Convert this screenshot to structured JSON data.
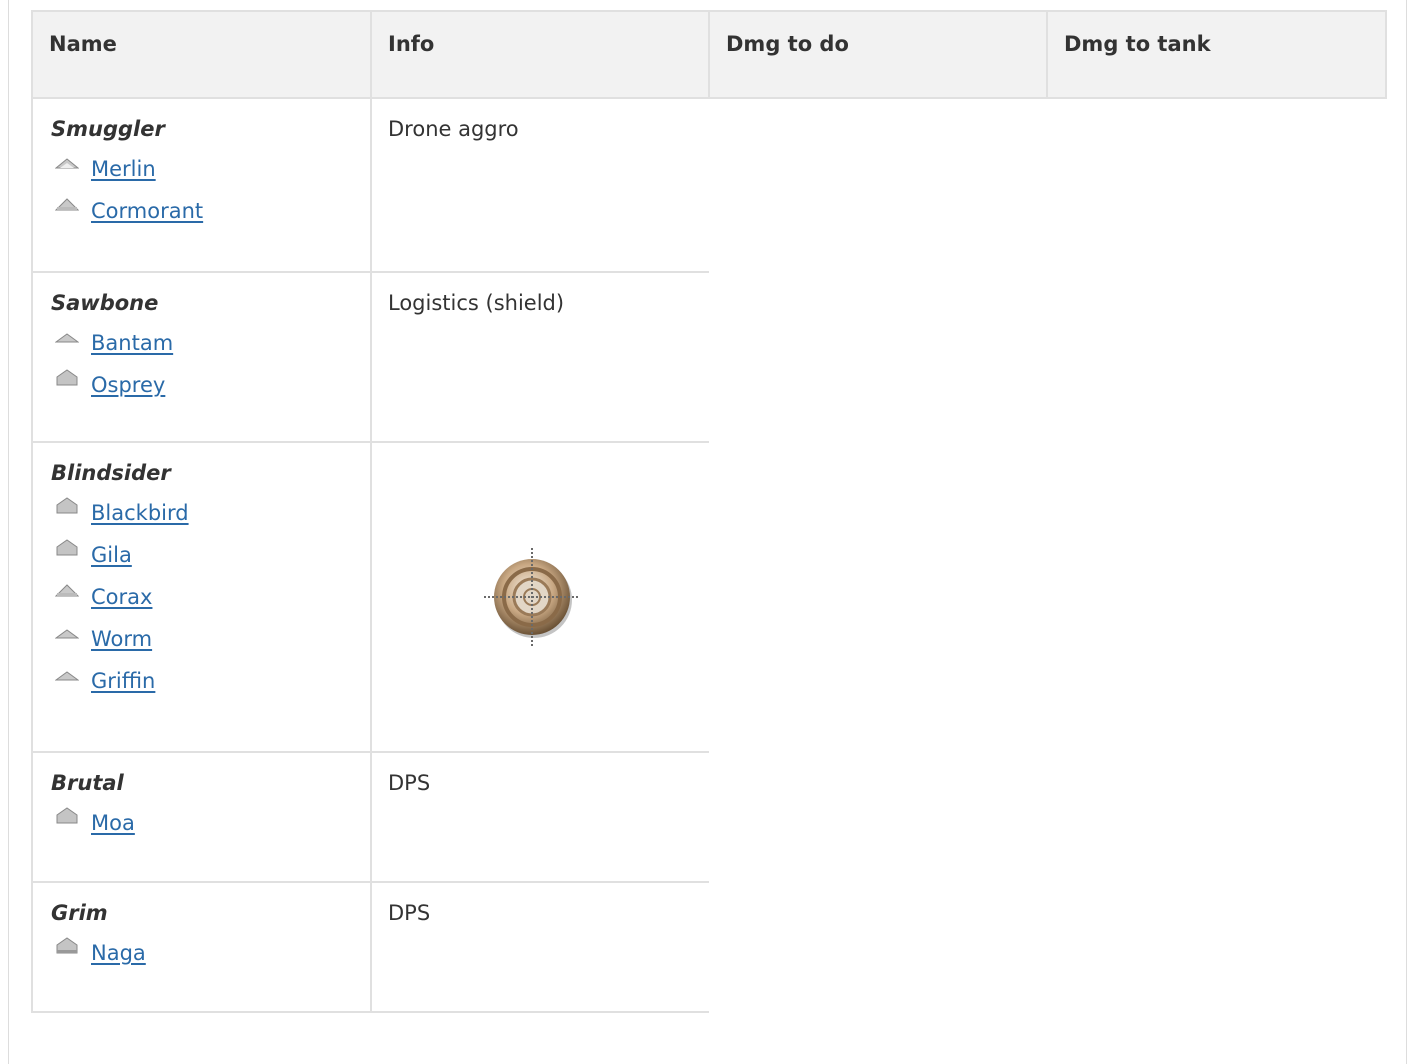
{
  "table": {
    "headers": [
      "Name",
      "Info",
      "Dmg to do",
      "Dmg to tank"
    ],
    "groups": [
      {
        "name": "Smuggler",
        "info": "Drone aggro",
        "ships": [
          "Merlin",
          "Cormorant"
        ]
      },
      {
        "name": "Sawbone",
        "info": "Logistics (shield)",
        "ships": [
          "Bantam",
          "Osprey"
        ]
      },
      {
        "name": "Blindsider",
        "info": "",
        "ships": [
          "Blackbird",
          "Gila",
          "Corax",
          "Worm",
          "Griffin"
        ]
      },
      {
        "name": "Brutal",
        "info": "DPS",
        "ships": [
          "Moa"
        ]
      },
      {
        "name": "Grim",
        "info": "DPS",
        "ships": [
          "Naga"
        ]
      }
    ]
  },
  "icons": {
    "ship": "ship-hull-icon",
    "target": "crosshair-target-icon"
  },
  "colors": {
    "link": "#2a6aa8",
    "header_bg": "#f2f2f2",
    "border": "#e0e0e0"
  }
}
